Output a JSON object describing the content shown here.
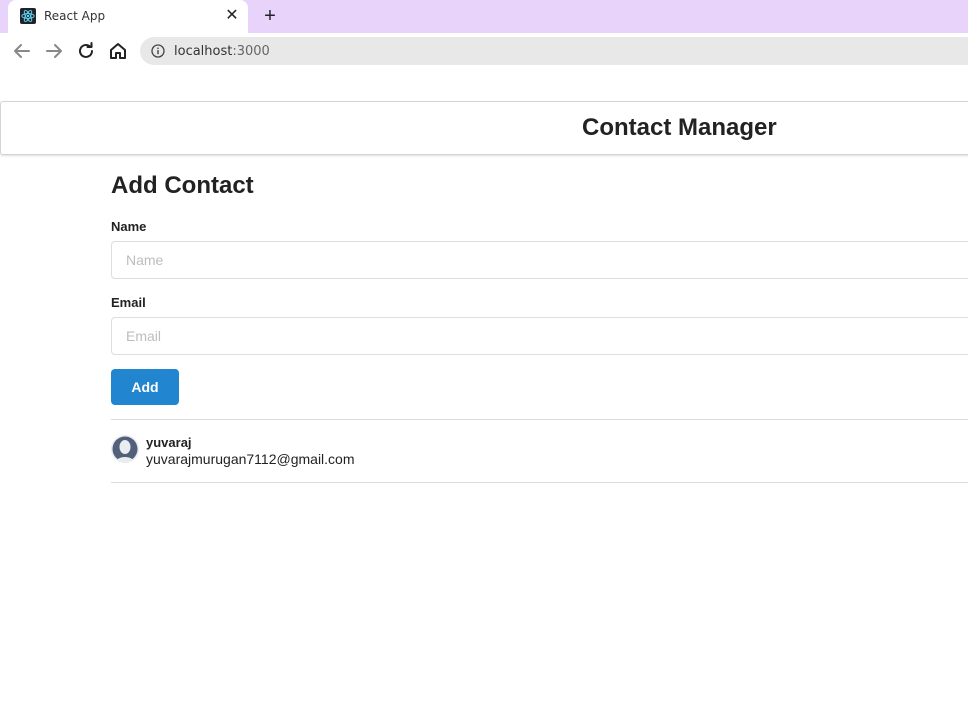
{
  "browser": {
    "tab_title": "React App",
    "favicon": "react-logo-icon",
    "url_host": "localhost",
    "url_port": ":3000",
    "tab_strip_color": "#e8d4fb"
  },
  "header": {
    "title": "Contact Manager"
  },
  "form": {
    "title": "Add Contact",
    "name_label": "Name",
    "name_placeholder": "Name",
    "name_value": "",
    "email_label": "Email",
    "email_placeholder": "Email",
    "email_value": "",
    "add_button": "Add",
    "accent_color": "#2185d0"
  },
  "contacts": [
    {
      "name": "yuvaraj",
      "email": "yuvarajmurugan7112@gmail.com",
      "avatar_icon": "user-avatar-icon"
    }
  ]
}
